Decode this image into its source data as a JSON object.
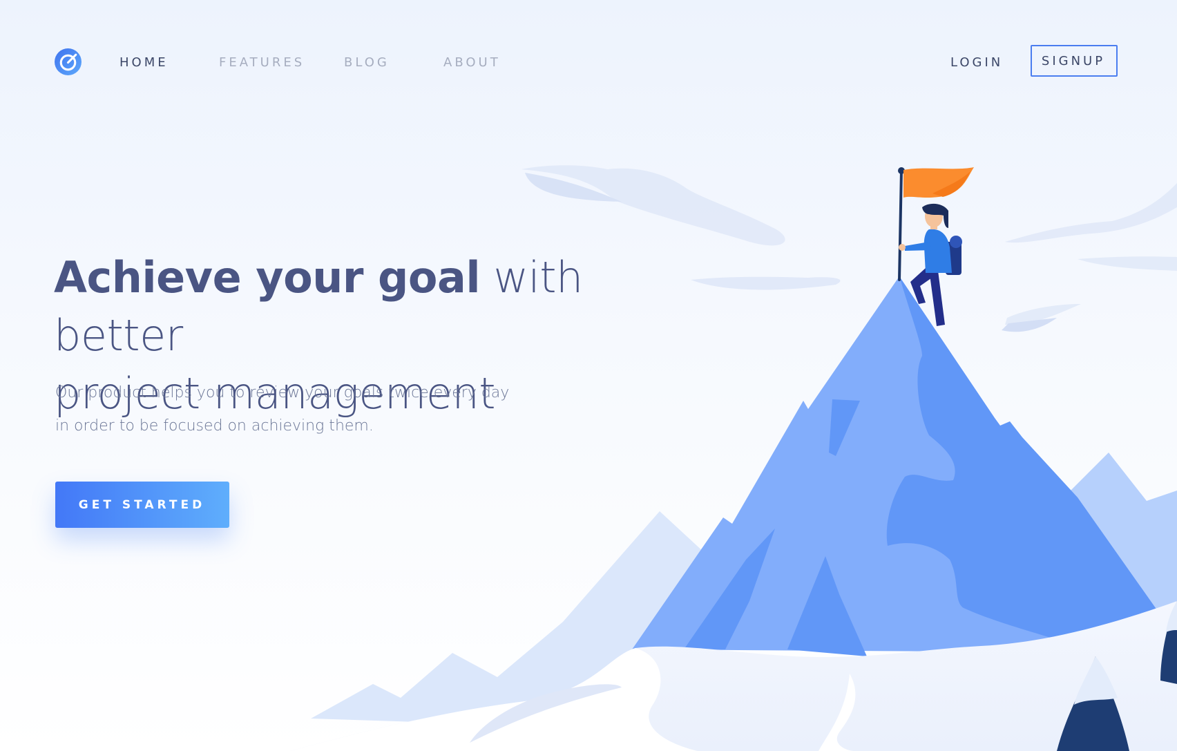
{
  "nav": {
    "links": [
      {
        "label": "HOME",
        "active": true
      },
      {
        "label": "FEATURES",
        "active": false
      },
      {
        "label": "BLOG",
        "active": false
      },
      {
        "label": "ABOUT",
        "active": false
      }
    ],
    "login_label": "LOGIN",
    "signup_label": "SIGNUP",
    "logo_icon": "target-icon"
  },
  "hero": {
    "title_bold": "Achieve your goal",
    "title_light_1": " with better",
    "title_light_2": "project management",
    "subtitle_line_1": "Our product helps you to review your goals twice every day",
    "subtitle_line_2": "in order to be focused on achieving them.",
    "cta_label": "GET STARTED"
  },
  "illustration": {
    "name": "mountain-climber-illustration",
    "elements": [
      "flag-icon",
      "climber-figure",
      "mountain-peak",
      "clouds",
      "pine-trees",
      "snow-ground"
    ]
  },
  "colors": {
    "accent": "#4a7df0",
    "heading": "#4a5583",
    "body_text": "#6b7696",
    "nav_inactive": "#a6adbf",
    "nav_active": "#3b4667",
    "flag": "#fb8c2e",
    "mountain_light": "#82adfb",
    "mountain_dark": "#5f95f6",
    "climber_shirt": "#2f7de6",
    "climber_pants": "#232e8a"
  }
}
